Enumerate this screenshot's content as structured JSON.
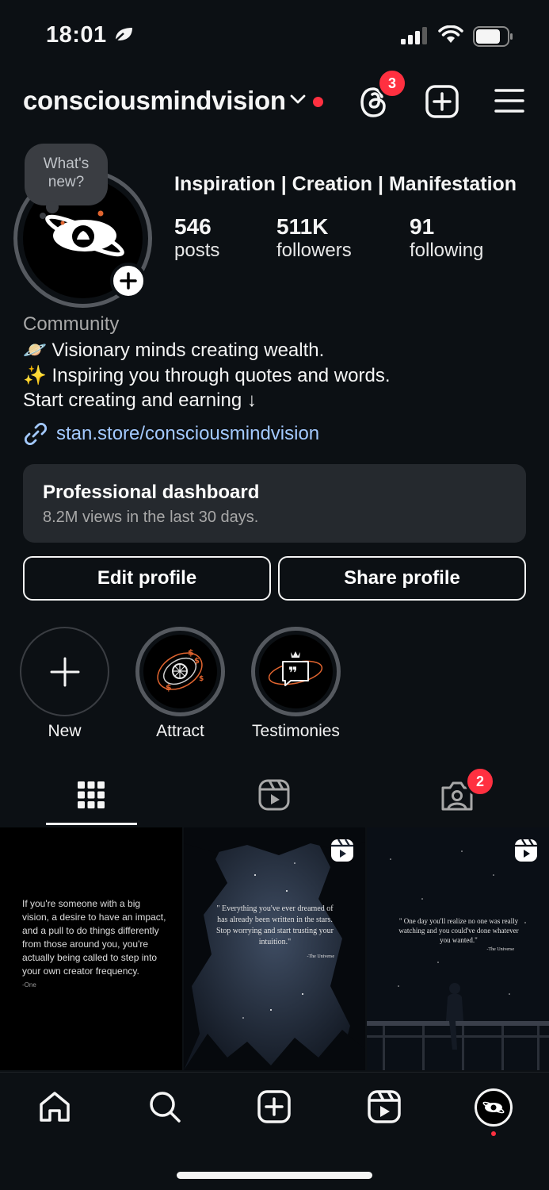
{
  "status_bar": {
    "time": "18:01"
  },
  "header": {
    "username": "consciousmindvision",
    "threads_badge": "3"
  },
  "profile": {
    "note": "What's new?",
    "tagline": "Inspiration | Creation | Manifestation",
    "stats": [
      {
        "value": "546",
        "label": "posts"
      },
      {
        "value": "511K",
        "label": "followers"
      },
      {
        "value": "91",
        "label": "following"
      }
    ],
    "category": "Community",
    "bio": [
      "🪐 Visionary minds creating wealth.",
      "✨ Inspiring you through quotes and words.",
      "Start creating and earning ↓"
    ],
    "link": "stan.store/consciousmindvision"
  },
  "dashboard": {
    "title": "Professional dashboard",
    "subtitle": "8.2M views in the last 30 days."
  },
  "buttons": {
    "edit": "Edit profile",
    "share": "Share profile"
  },
  "highlights": [
    {
      "label": "New"
    },
    {
      "label": "Attract"
    },
    {
      "label": "Testimonies"
    }
  ],
  "tabs": {
    "tagged_badge": "2"
  },
  "posts": [
    {
      "text": "If you're someone with a big vision, a desire to have an impact, and a pull to do things differently from those around you, you're actually being called to step into your own creator frequency.",
      "author": "-One"
    },
    {
      "text": "\" Everything you've ever dreamed of has already been written in the stars. Stop worrying and start trusting your intuition.\"",
      "author": "-The Universe"
    },
    {
      "text": "\" One day you'll realize no one was really watching and you could've done whatever you wanted.\"",
      "author": "-The Universe"
    }
  ],
  "colors": {
    "accent_red": "#ff3040",
    "link_blue": "#a3c9ff",
    "background": "#0c1014"
  }
}
